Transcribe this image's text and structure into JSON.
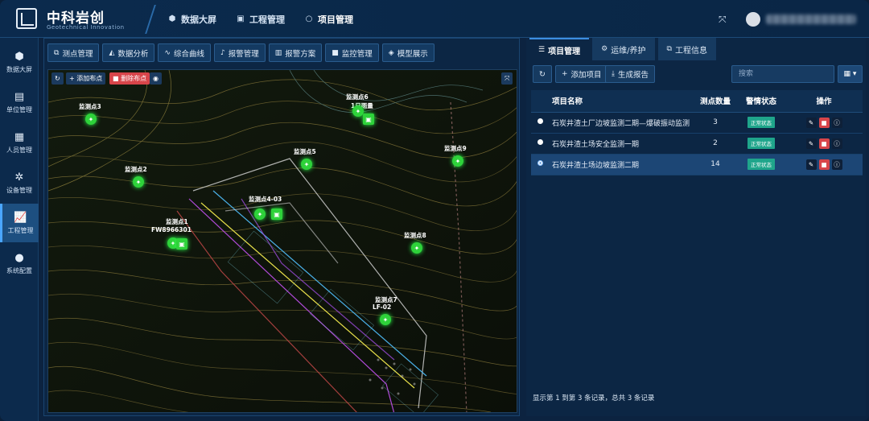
{
  "brand": {
    "title": "中科岩创",
    "subtitle": "Geotechnical Innovation"
  },
  "topnav": [
    {
      "label": "数据大屏",
      "icon": "cube-icon"
    },
    {
      "label": "工程管理",
      "icon": "monitor-icon"
    },
    {
      "label": "项目管理",
      "icon": "circle-icon",
      "active": true
    }
  ],
  "sidebar": [
    {
      "label": "数据大屏",
      "icon": "cube-icon"
    },
    {
      "label": "单位管理",
      "icon": "calendar-icon"
    },
    {
      "label": "人员管理",
      "icon": "id-card-icon"
    },
    {
      "label": "设备管理",
      "icon": "gear-icon"
    },
    {
      "label": "工程管理",
      "icon": "chart-icon",
      "active": true
    },
    {
      "label": "系统配置",
      "icon": "dots-icon"
    }
  ],
  "toolbar": [
    {
      "label": "测点管理",
      "icon": "nodes-icon"
    },
    {
      "label": "数据分析",
      "icon": "area-chart-icon"
    },
    {
      "label": "综合曲线",
      "icon": "line-chart-icon"
    },
    {
      "label": "报警管理",
      "icon": "bell-icon"
    },
    {
      "label": "报警方案",
      "icon": "book-icon"
    },
    {
      "label": "监控管理",
      "icon": "camera-icon"
    },
    {
      "label": "模型展示",
      "icon": "model-icon"
    }
  ],
  "map": {
    "add_point": "添加布点",
    "delete_point": "删除布点",
    "points": [
      {
        "label": "监测点3"
      },
      {
        "label": "监测点2"
      },
      {
        "label": "监测点6"
      },
      {
        "label": "1日雨量"
      },
      {
        "label": "监测点5"
      },
      {
        "label": "监测点9"
      },
      {
        "label": "监测点1"
      },
      {
        "label": "FW8966301"
      },
      {
        "label": "监测点4-03"
      },
      {
        "label": "监测点8"
      },
      {
        "label": "监测点7"
      },
      {
        "label": "LF-02"
      }
    ]
  },
  "right": {
    "tabs": [
      {
        "label": "项目管理",
        "icon": "list-icon",
        "active": true
      },
      {
        "label": "运维/养护",
        "icon": "gears-icon"
      },
      {
        "label": "工程信息",
        "icon": "cubes-icon"
      }
    ],
    "add_project": "添加项目",
    "generate_report": "生成报告",
    "search_placeholder": "搜索",
    "table": {
      "headers": [
        "项目名称",
        "测点数量",
        "警情状态",
        "操作"
      ],
      "rows": [
        {
          "name": "石炭井渣土厂边坡监测二期—爆破振动监测",
          "count": "3",
          "status": "正常状态"
        },
        {
          "name": "石炭井渣土场安全监测一期",
          "count": "2",
          "status": "正常状态"
        },
        {
          "name": "石炭井渣土场边坡监测二期",
          "count": "14",
          "status": "正常状态",
          "selected": true
        }
      ]
    },
    "footer": "显示第 1 到第 3 条记录，总共 3 条记录"
  },
  "colors": {
    "accent": "#3c8ee0",
    "point": "#2ed23a",
    "badge": "#1fa58b",
    "delete": "#d8454a"
  }
}
